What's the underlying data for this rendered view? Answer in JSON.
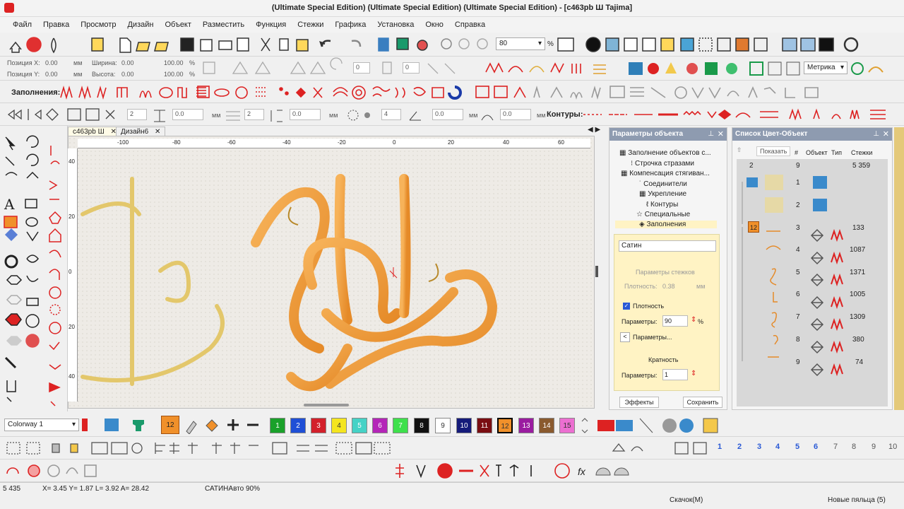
{
  "window": {
    "title": "(Ultimate Special Edition) (Ultimate Special Edition) (Ultimate Special Edition) - [c463pb Ш    Tajima]"
  },
  "menu": [
    "Файл",
    "Правка",
    "Просмотр",
    "Дизайн",
    "Объект",
    "Разместить",
    "Функция",
    "Стежки",
    "Графика",
    "Установка",
    "Окно",
    "Справка"
  ],
  "toolbar1": {
    "zoom_value": "80",
    "zoom_unit": "%"
  },
  "position": {
    "x_label": "Позиция X:",
    "x_value": "0.00",
    "y_label": "Позиция Y:",
    "y_value": "0.00",
    "mm1": "мм",
    "mm2": "мм",
    "width_label": "Ширина:",
    "width_value": "0.00",
    "height_label": "Высота:",
    "height_value": "0.00",
    "w_pct": "100.00",
    "h_pct": "100.00",
    "pct1": "%",
    "pct2": "%",
    "rot1": "0",
    "rot2": "0"
  },
  "units_select": "Метрика",
  "fills_label": "Заполнения:",
  "row3": {
    "v1": "2",
    "v2": "0.0",
    "mm1": "мм",
    "v3": "2",
    "v4": "0.0",
    "mm2": "мм",
    "v5": "4",
    "v6": "0.0",
    "mm3": "мм",
    "v7": "0.0",
    "mm4": "мм",
    "contours_label": "Контуры:"
  },
  "tabs": {
    "doc1": "c463pb Ш",
    "doc2": "Дизайн6"
  },
  "ruler": {
    "h": [
      "-100",
      "-80",
      "-60",
      "-40",
      "-20",
      "0",
      "20",
      "40",
      "60"
    ],
    "v": [
      "40",
      "20",
      "0",
      "20",
      "40"
    ]
  },
  "object_params": {
    "title": "Параметры объекта",
    "items": [
      "Заполнение объектов с...",
      "Строчка стразами",
      "Компенсация стягиван...",
      "Соединители",
      "Укрепление",
      "Контуры",
      "Специальные",
      "Заполнения"
    ],
    "fill_type": "Сатин",
    "stitch_params": "Параметры стежков",
    "density_label": "Плотность:",
    "density_value": "0.38",
    "density_unit": "мм",
    "density_check": "Плотность",
    "params_label": "Параметры:",
    "params_value": "90",
    "params_unit": "%",
    "params_more": "Параметры...",
    "multiplicity": "Кратность",
    "params2_label": "Параметры:",
    "params2_value": "1",
    "effects_btn": "Эффекты",
    "save_btn": "Сохранить"
  },
  "color_list": {
    "title": "Список Цвет-Объект",
    "show_btn": "Показать",
    "headers": {
      "num": "#",
      "object": "Объект",
      "type": "Тип",
      "stitches": "Стежки"
    },
    "summary": {
      "a": "2",
      "b": "9",
      "stitches": "5 359"
    },
    "rows": [
      {
        "num": "1",
        "stitches": ""
      },
      {
        "num": "2",
        "stitches": ""
      },
      {
        "num": "3",
        "stitches": "133",
        "color_badge": "12"
      },
      {
        "num": "4",
        "stitches": "1087"
      },
      {
        "num": "5",
        "stitches": "1371"
      },
      {
        "num": "6",
        "stitches": "1005"
      },
      {
        "num": "7",
        "stitches": "1309"
      },
      {
        "num": "8",
        "stitches": "380"
      },
      {
        "num": "9",
        "stitches": "74"
      }
    ]
  },
  "colorway": {
    "name": "Colorway 1",
    "current": "12"
  },
  "palette": [
    {
      "n": "1",
      "c": "#1aa12a"
    },
    {
      "n": "2",
      "c": "#1f4fd6"
    },
    {
      "n": "3",
      "c": "#d3202b"
    },
    {
      "n": "4",
      "c": "#f4e51f"
    },
    {
      "n": "5",
      "c": "#45d2c6"
    },
    {
      "n": "6",
      "c": "#b425b8"
    },
    {
      "n": "7",
      "c": "#3ee04c"
    },
    {
      "n": "8",
      "c": "#111111"
    },
    {
      "n": "9",
      "c": "#ffffff"
    },
    {
      "n": "10",
      "c": "#151b7a"
    },
    {
      "n": "11",
      "c": "#7a0d12"
    },
    {
      "n": "12",
      "c": "#f0902a"
    },
    {
      "n": "13",
      "c": "#9a1da0"
    },
    {
      "n": "14",
      "c": "#8a5a2e"
    },
    {
      "n": "15",
      "c": "#ec6fd1"
    }
  ],
  "hoop_numbers": [
    "1",
    "2",
    "3",
    "4",
    "5",
    "6",
    "7",
    "8",
    "9",
    "10"
  ],
  "status": {
    "count": "5 435",
    "coords": "X=  3.45 Y=  1.87 L=  3.92 A= 28.42",
    "mode": "САТИНАвто 90%",
    "download": "Скачок(М)",
    "hoops": "Новые пяльца (5)"
  }
}
